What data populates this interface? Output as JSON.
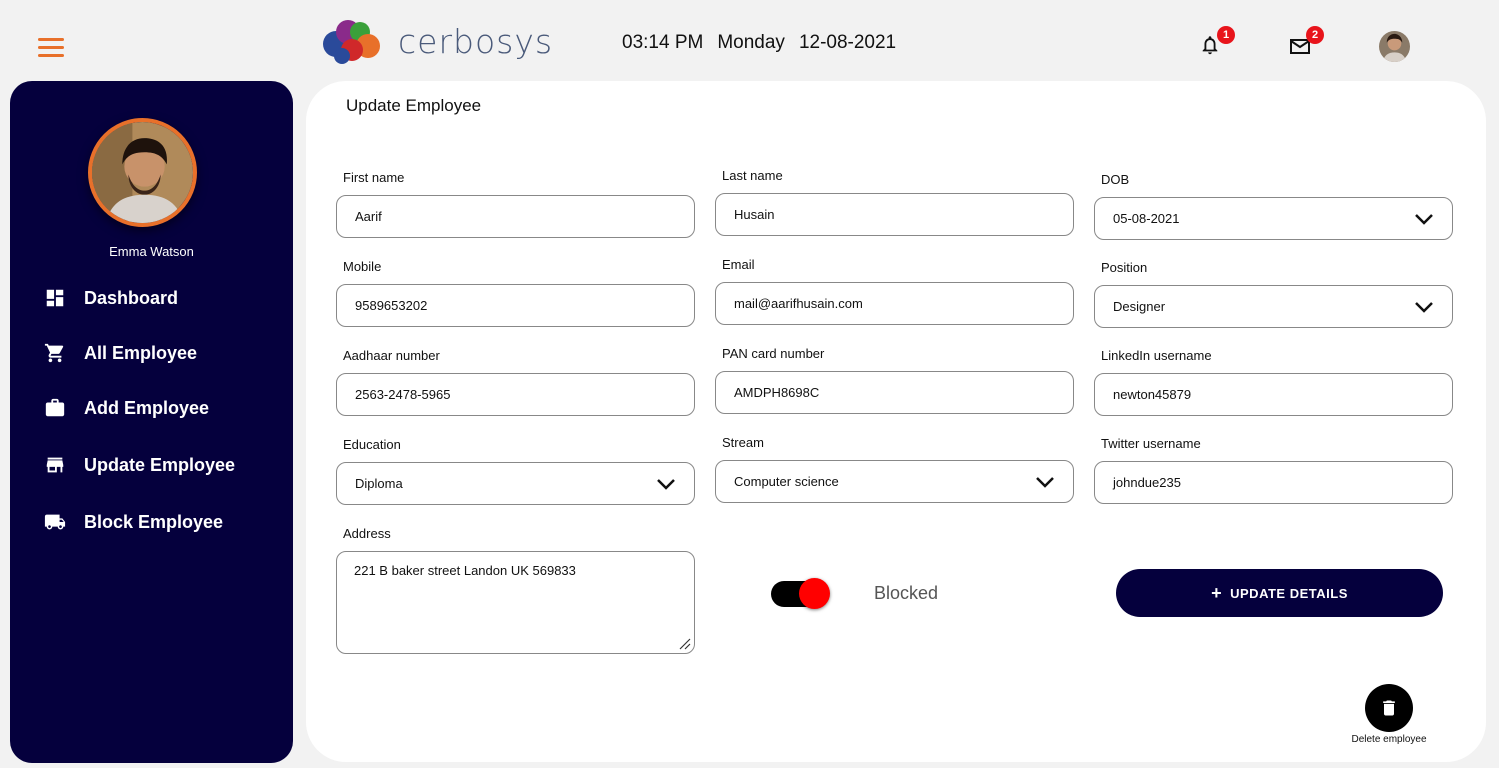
{
  "header": {
    "logo_text": "cerbosys",
    "time": "03:14 PM",
    "day": "Monday",
    "date": "12-08-2021",
    "notifications_count": "1",
    "messages_count": "2"
  },
  "sidebar": {
    "user_name": "Emma Watson",
    "items": [
      {
        "label": "Dashboard",
        "icon": "dashboard-icon"
      },
      {
        "label": "All Employee",
        "icon": "cart-icon"
      },
      {
        "label": "Add Employee",
        "icon": "briefcase-icon"
      },
      {
        "label": "Update Employee",
        "icon": "store-icon"
      },
      {
        "label": "Block Employee",
        "icon": "truck-icon"
      }
    ]
  },
  "form": {
    "title": "Update Employee",
    "first_name": {
      "label": "First name",
      "value": "Aarif"
    },
    "last_name": {
      "label": "Last name",
      "value": "Husain"
    },
    "dob": {
      "label": "DOB",
      "value": "05-08-2021"
    },
    "mobile": {
      "label": "Mobile",
      "value": "9589653202"
    },
    "email": {
      "label": "Email",
      "value": "mail@aarifhusain.com"
    },
    "position": {
      "label": "Position",
      "value": "Designer"
    },
    "aadhaar": {
      "label": "Aadhaar number",
      "value": "2563-2478-5965"
    },
    "pan": {
      "label": "PAN card number",
      "value": "AMDPH8698C"
    },
    "linkedin": {
      "label": "LinkedIn username",
      "value": "newton45879"
    },
    "education": {
      "label": "Education",
      "value": "Diploma"
    },
    "stream": {
      "label": "Stream",
      "value": "Computer science"
    },
    "twitter": {
      "label": "Twitter username",
      "value": "johndue235"
    },
    "address": {
      "label": "Address",
      "value": "221 B baker street Landon UK 569833"
    },
    "blocked_label": "Blocked",
    "blocked": true,
    "update_button": "UPDATE DETAILS",
    "delete_label": "Delete employee"
  },
  "colors": {
    "navy": "#05003d",
    "accent": "#e8702a",
    "badge": "#e8141b",
    "toggle_on": "#ff0000"
  }
}
